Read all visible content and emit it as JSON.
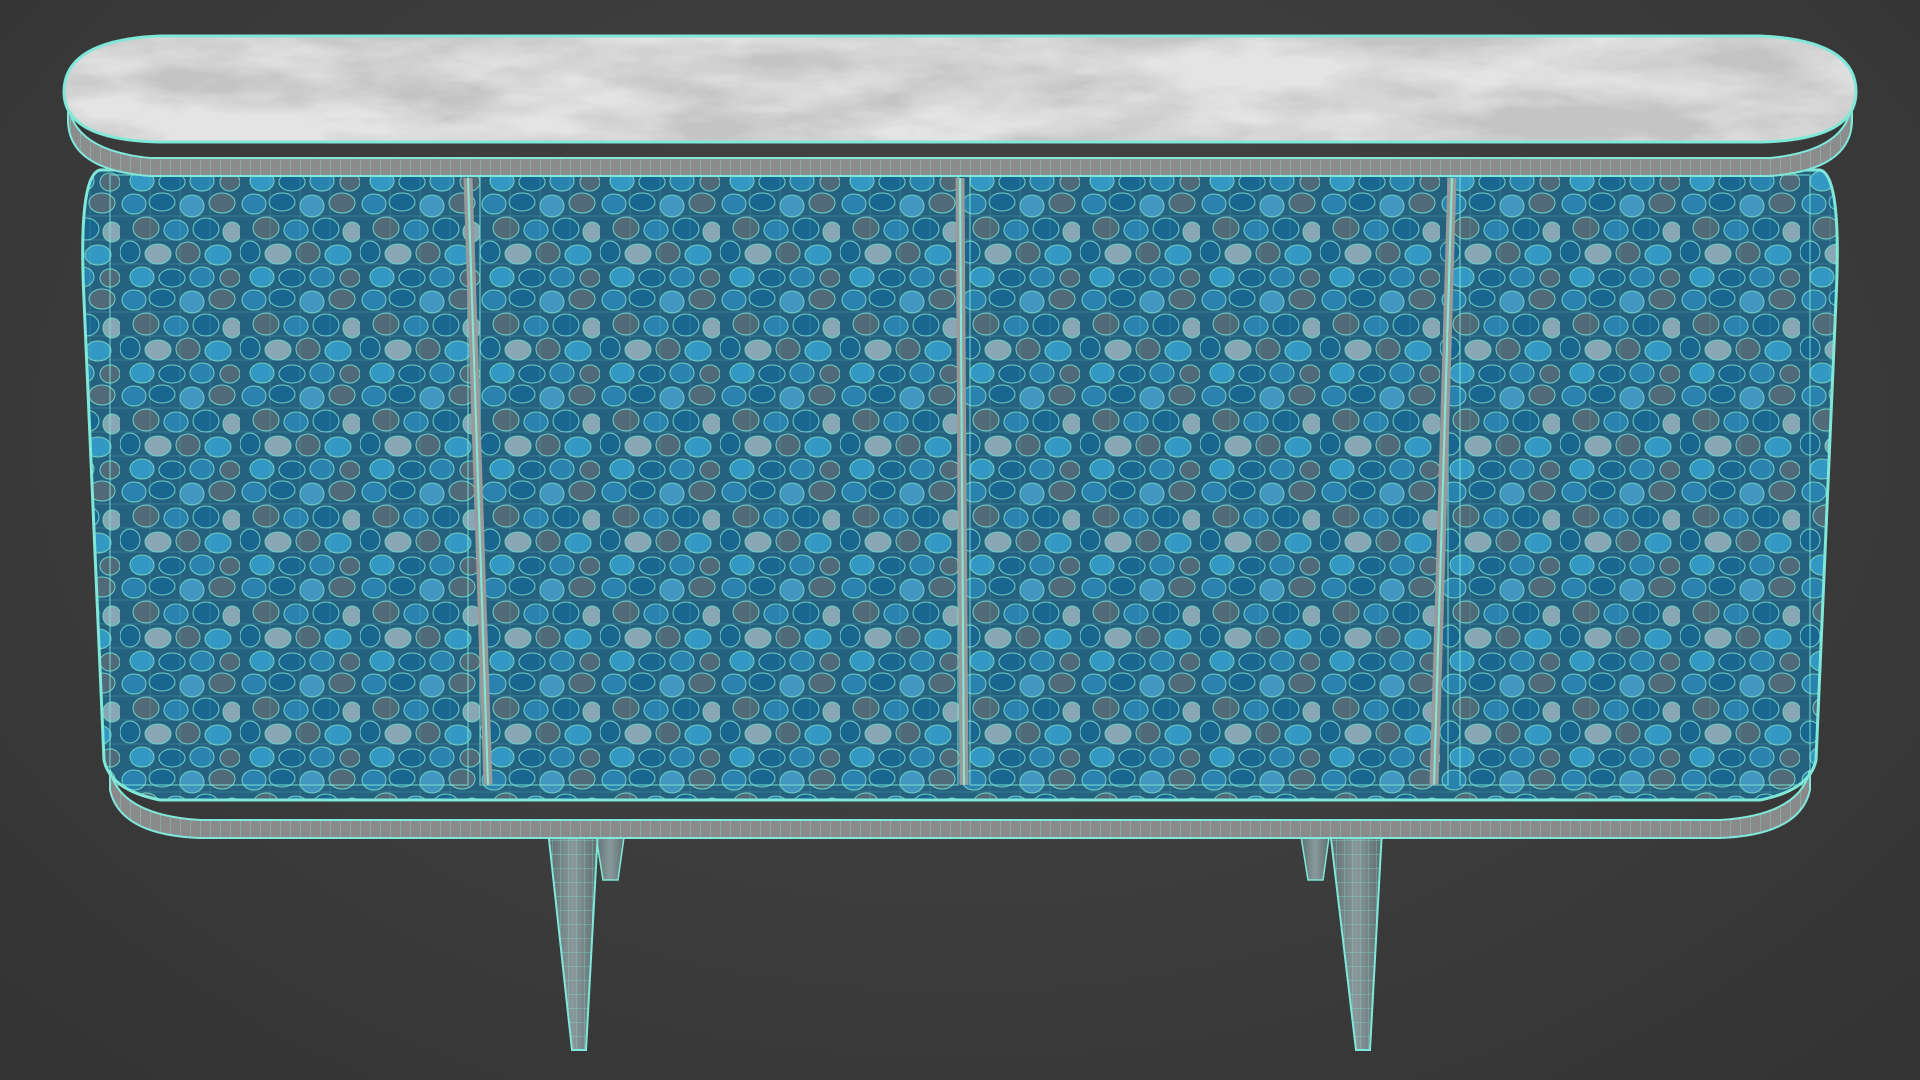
{
  "viewport": {
    "background_color": "#3b3b3b",
    "wireframe_color": "#7fe8d8",
    "selection_state": "selected-wireframe-overlay"
  },
  "model": {
    "object_type": "sideboard-cabinet",
    "door_panel_count": 4,
    "leg_count": 4,
    "top_material_colors": [
      "#e6e6e6",
      "#5a5a5a"
    ],
    "panel_material_colors": [
      "#1f7fae",
      "#3aa8d6",
      "#5a6f7a",
      "#9ab8c4"
    ],
    "frame_band_color": "#8a8a8a",
    "leg_color": "#7a8a8a"
  }
}
